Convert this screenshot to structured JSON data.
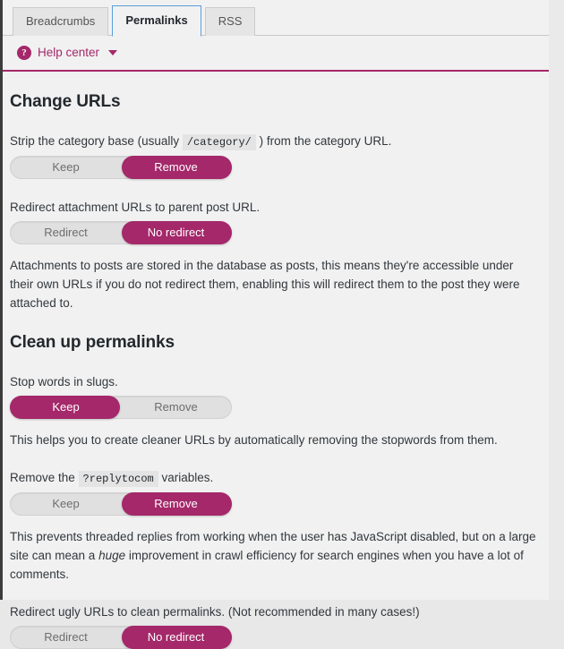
{
  "window": {
    "tabs": [
      {
        "label": "Breadcrumbs",
        "active": false
      },
      {
        "label": "Permalinks",
        "active": true
      },
      {
        "label": "RSS",
        "active": false
      }
    ]
  },
  "help": {
    "icon": "question-mark-circle-icon",
    "label": "Help center",
    "caret": "chevron-down-icon"
  },
  "colors": {
    "accent": "#a4286a",
    "tab_active_border": "#5b9dd9",
    "page_background": "#f1f1f1",
    "toggle_track": "#e0e0e0",
    "text": "#32373c"
  },
  "sections": [
    {
      "title": "Change URLs",
      "fields": [
        {
          "label_parts": [
            {
              "type": "text",
              "value": "Strip the category base (usually "
            },
            {
              "type": "code",
              "value": "/category/"
            },
            {
              "type": "text",
              "value": " ) from the category URL."
            }
          ],
          "toggle": {
            "left_label": "Keep",
            "right_label": "Remove",
            "active": "right"
          },
          "description": ""
        },
        {
          "label_parts": [
            {
              "type": "text",
              "value": "Redirect attachment URLs to parent post URL."
            }
          ],
          "toggle": {
            "left_label": "Redirect",
            "right_label": "No redirect",
            "active": "right"
          },
          "description": "Attachments to posts are stored in the database as posts, this means they're accessible under their own URLs if you do not redirect them, enabling this will redirect them to the post they were attached to."
        }
      ]
    },
    {
      "title": "Clean up permalinks",
      "fields": [
        {
          "label_parts": [
            {
              "type": "text",
              "value": "Stop words in slugs."
            }
          ],
          "toggle": {
            "left_label": "Keep",
            "right_label": "Remove",
            "active": "left"
          },
          "description": "This helps you to create cleaner URLs by automatically removing the stopwords from them."
        },
        {
          "label_parts": [
            {
              "type": "text",
              "value": "Remove the "
            },
            {
              "type": "code",
              "value": "?replytocom"
            },
            {
              "type": "text",
              "value": " variables."
            }
          ],
          "toggle": {
            "left_label": "Keep",
            "right_label": "Remove",
            "active": "right"
          },
          "description_parts": [
            {
              "type": "text",
              "value": "This prevents threaded replies from working when the user has JavaScript disabled, but on a large site can mean a "
            },
            {
              "type": "em",
              "value": "huge"
            },
            {
              "type": "text",
              "value": " improvement in crawl efficiency for search engines when you have a lot of comments."
            }
          ]
        },
        {
          "label_parts": [
            {
              "type": "text",
              "value": "Redirect ugly URLs to clean permalinks. (Not recommended in many cases!)"
            }
          ],
          "toggle": {
            "left_label": "Redirect",
            "right_label": "No redirect",
            "active": "right"
          },
          "description": ""
        }
      ]
    }
  ]
}
